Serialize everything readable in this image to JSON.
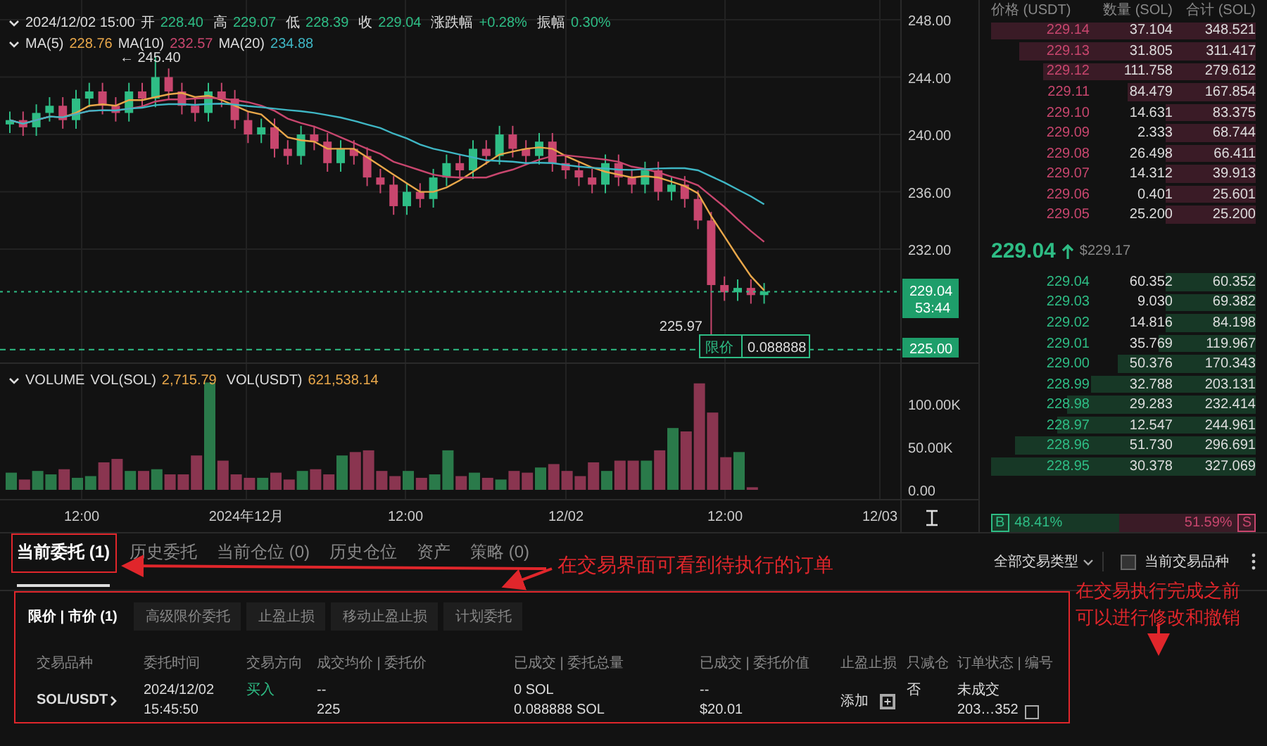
{
  "candle_header": {
    "datetime": "2024/12/02 15:00",
    "fields": [
      {
        "label": "开",
        "value": "228.40"
      },
      {
        "label": "高",
        "value": "229.07"
      },
      {
        "label": "低",
        "value": "228.39"
      },
      {
        "label": "收",
        "value": "229.04"
      },
      {
        "label": "涨跌幅",
        "value": "+0.28%"
      },
      {
        "label": "振幅",
        "value": "0.30%"
      }
    ]
  },
  "ma_header": [
    {
      "label": "MA(5)",
      "value": "228.76",
      "color": "#e8a74a"
    },
    {
      "label": "MA(10)",
      "value": "232.57",
      "color": "#c8466e"
    },
    {
      "label": "MA(20)",
      "value": "234.88",
      "color": "#3fb6c4"
    }
  ],
  "chart_marks": {
    "high_label": "← 245.40",
    "low_label": "225.97",
    "last_price": "229.04",
    "countdown": "53:44",
    "limit_price": "225.00",
    "limit_order": {
      "label": "限价",
      "amount": "0.088888"
    }
  },
  "price_axis": [
    "248.00",
    "244.00",
    "240.00",
    "236.00",
    "232.00"
  ],
  "volume_header": {
    "title": "VOLUME",
    "fields": [
      {
        "label": "VOL(SOL)",
        "value": "2,715.79"
      },
      {
        "label": "VOL(USDT)",
        "value": "621,538.14"
      }
    ]
  },
  "volume_axis": [
    "100.00K",
    "50.00K",
    "0.00"
  ],
  "time_axis": [
    "12:00",
    "2024年12月",
    "12:00",
    "12/02",
    "12:00",
    "12/03"
  ],
  "order_book": {
    "columns": [
      "价格 (USDT)",
      "数量 (SOL)",
      "合计 (SOL)"
    ],
    "asks": [
      {
        "price": "229.14",
        "amount": "37.104",
        "total": "348.521"
      },
      {
        "price": "229.13",
        "amount": "31.805",
        "total": "311.417"
      },
      {
        "price": "229.12",
        "amount": "111.758",
        "total": "279.612"
      },
      {
        "price": "229.11",
        "amount": "84.479",
        "total": "167.854"
      },
      {
        "price": "229.10",
        "amount": "14.631",
        "total": "83.375"
      },
      {
        "price": "229.09",
        "amount": "2.333",
        "total": "68.744"
      },
      {
        "price": "229.08",
        "amount": "26.498",
        "total": "66.411"
      },
      {
        "price": "229.07",
        "amount": "14.312",
        "total": "39.913"
      },
      {
        "price": "229.06",
        "amount": "0.401",
        "total": "25.601"
      },
      {
        "price": "229.05",
        "amount": "25.200",
        "total": "25.200"
      }
    ],
    "last_price": "229.04",
    "last_price_usd": "$229.17",
    "bids": [
      {
        "price": "229.04",
        "amount": "60.352",
        "total": "60.352"
      },
      {
        "price": "229.03",
        "amount": "9.030",
        "total": "69.382"
      },
      {
        "price": "229.02",
        "amount": "14.816",
        "total": "84.198"
      },
      {
        "price": "229.01",
        "amount": "35.769",
        "total": "119.967"
      },
      {
        "price": "229.00",
        "amount": "50.376",
        "total": "170.343"
      },
      {
        "price": "228.99",
        "amount": "32.788",
        "total": "203.131"
      },
      {
        "price": "228.98",
        "amount": "29.283",
        "total": "232.414"
      },
      {
        "price": "228.97",
        "amount": "12.547",
        "total": "244.961"
      },
      {
        "price": "228.96",
        "amount": "51.730",
        "total": "296.691"
      },
      {
        "price": "228.95",
        "amount": "30.378",
        "total": "327.069"
      }
    ],
    "ratio": {
      "buy_label": "B",
      "buy_share": "48.41%",
      "sell_share": "51.59%",
      "sell_label": "S",
      "level": 0.4841
    }
  },
  "order_tabs": [
    {
      "label": "当前委托 (1)",
      "selected": true
    },
    {
      "label": "历史委托",
      "selected": false
    },
    {
      "label": "当前仓位 (0)",
      "selected": false
    },
    {
      "label": "历史仓位",
      "selected": false
    },
    {
      "label": "资产",
      "selected": false
    },
    {
      "label": "策略 (0)",
      "selected": false
    }
  ],
  "filters": {
    "type_dropdown": "全部交易类型",
    "current_symbol": {
      "label": "当前交易品种",
      "checked": false
    }
  },
  "sub_tabs": [
    {
      "label": "限价 | 市价 (1)",
      "selected": true
    },
    {
      "label": "高级限价委托",
      "selected": false
    },
    {
      "label": "止盈止损",
      "selected": false
    },
    {
      "label": "移动止盈止损",
      "selected": false
    },
    {
      "label": "计划委托",
      "selected": false
    }
  ],
  "order_columns": [
    "交易品种",
    "委托时间",
    "交易方向",
    "成交均价 | 委托价",
    "已成交 | 委托总量",
    "已成交 | 委托价值",
    "止盈止损",
    "只减仓",
    "订单状态 | 编号"
  ],
  "order_rows": [
    {
      "symbol": "SOL/USDT",
      "time": [
        "2024/12/02",
        "15:45:50"
      ],
      "side": "买入",
      "price": [
        "--",
        "225"
      ],
      "quantity": [
        "0 SOL",
        "0.088888 SOL"
      ],
      "value": [
        "--",
        "$20.01"
      ],
      "tpsl": "添加",
      "reduce_only": "否",
      "status": [
        "未成交",
        "203…352"
      ]
    }
  ],
  "annotations": [
    {
      "lines": [
        "在交易界面可看到待执行的订单"
      ]
    },
    {
      "lines": [
        "在交易执行完成之前",
        "可以进行修改和撤销"
      ]
    }
  ]
}
